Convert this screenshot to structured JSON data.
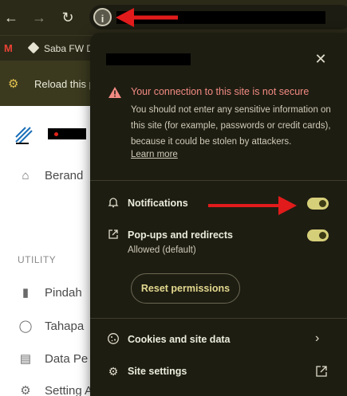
{
  "toolbar": {
    "back_icon": "arrow-left-icon",
    "forward_icon": "arrow-right-icon",
    "reload_icon": "reload-icon",
    "site_info_icon": "info-icon"
  },
  "bookmarks": [
    {
      "icon": "gmail-icon",
      "label": "M"
    },
    {
      "icon": "saba-icon",
      "label": "Saba FW D"
    }
  ],
  "infobar": {
    "icon": "gear-icon",
    "text": "Reload this p"
  },
  "page": {
    "nav_items": [
      {
        "icon": "home-icon",
        "label": "Berand"
      },
      {
        "icon": "bar-chart-icon",
        "label": "Pindah"
      },
      {
        "icon": "circle-icon",
        "label": "Tahapa"
      },
      {
        "icon": "database-icon",
        "label": "Data Pe"
      },
      {
        "icon": "gear-icon",
        "label": "Setting Aplikasi"
      }
    ],
    "section_label": "UTILITY"
  },
  "popup": {
    "close_icon": "close-icon",
    "warning": {
      "icon": "warning-triangle-icon",
      "title": "Your connection to this site is not secure",
      "description": "You should not enter any sensitive information on this site (for example, passwords or credit cards), because it could be stolen by attackers.",
      "link": "Learn more"
    },
    "permissions": [
      {
        "icon": "bell-icon",
        "label": "Notifications",
        "enabled": true
      },
      {
        "icon": "external-window-icon",
        "label": "Pop-ups and redirects",
        "sub": "Allowed (default)",
        "enabled": true
      }
    ],
    "reset_label": "Reset permissions",
    "links": [
      {
        "icon": "cookie-icon",
        "label": "Cookies and site data",
        "trail_icon": "chevron-right-icon"
      },
      {
        "icon": "gear-icon",
        "label": "Site settings",
        "trail_icon": "open-external-icon"
      }
    ]
  },
  "colors": {
    "toolbar_bg": "#2b2a19",
    "popup_bg": "#1e1d12",
    "warning_red": "#f28b82",
    "toggle_on": "#d6cf7a",
    "annotation_red": "#e11b1b"
  }
}
